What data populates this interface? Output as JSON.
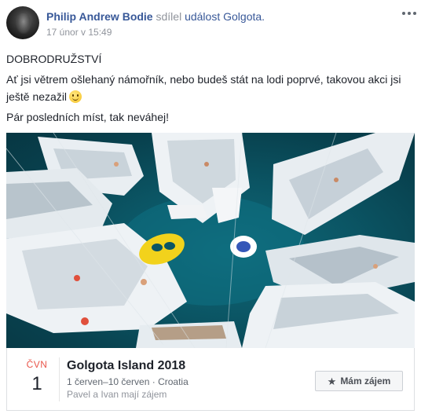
{
  "post": {
    "author": "Philip Andrew Bodie",
    "verb": "sdílel",
    "event_prefix": "událost",
    "event_name": "Golgota.",
    "timestamp": "17 únor v 15:49",
    "line1": "DOBRODRUŽSTVÍ",
    "line2": "Ať jsi větrem ošlehaný námořník, nebo budeš stát na lodi poprvé, takovou akci jsi ještě nezažil",
    "line3": "Pár posledních míst, tak neváhej!"
  },
  "event": {
    "month": "ČVN",
    "day": "1",
    "title": "Golgota Island 2018",
    "meta": "1 červen–10 červen · Croatia",
    "friends": "Pavel a Ivan mají zájem",
    "interest_label": "Mám zájem"
  },
  "icons": {
    "more": "more-horizontal-icon",
    "star": "star-icon",
    "emoji": "smiley-emoji"
  },
  "colors": {
    "link": "#385898",
    "meta": "#90949c",
    "month": "#e9564b"
  }
}
